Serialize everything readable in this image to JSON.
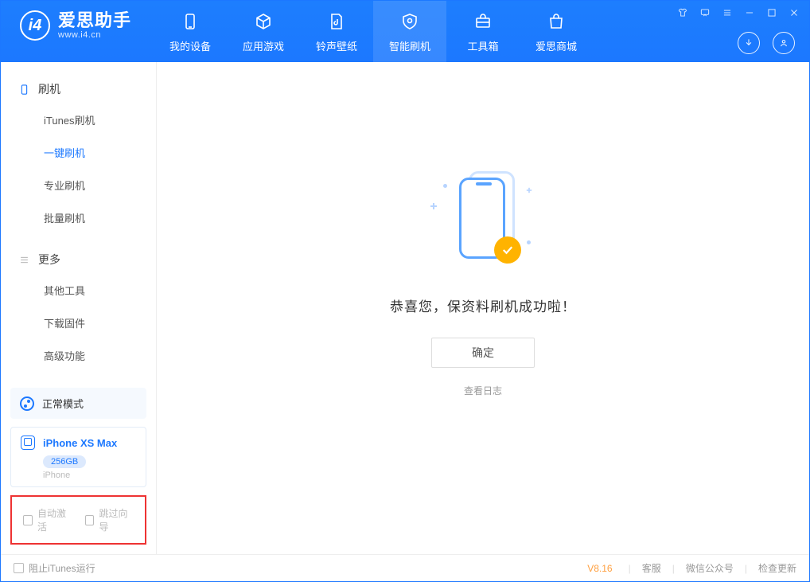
{
  "brand": {
    "title": "爱思助手",
    "subtitle": "www.i4.cn",
    "logo_char": "i4"
  },
  "navtabs": {
    "device": "我的设备",
    "apps": "应用游戏",
    "ringtone": "铃声壁纸",
    "flash": "智能刷机",
    "toolbox": "工具箱",
    "store": "爱思商城"
  },
  "sidebar": {
    "group_flash": "刷机",
    "items_flash": {
      "itunes": "iTunes刷机",
      "oneclick": "一键刷机",
      "pro": "专业刷机",
      "batch": "批量刷机"
    },
    "group_more": "更多",
    "items_more": {
      "other": "其他工具",
      "firmware": "下载固件",
      "advanced": "高级功能"
    },
    "status": "正常模式",
    "device": {
      "name": "iPhone XS Max",
      "storage": "256GB",
      "type": "iPhone"
    },
    "chk_auto": "自动激活",
    "chk_skip": "跳过向导"
  },
  "main": {
    "success": "恭喜您，保资料刷机成功啦！",
    "ok": "确定",
    "viewlog": "查看日志"
  },
  "footer": {
    "block_itunes": "阻止iTunes运行",
    "version": "V8.16",
    "support": "客服",
    "wechat": "微信公众号",
    "update": "检查更新"
  }
}
